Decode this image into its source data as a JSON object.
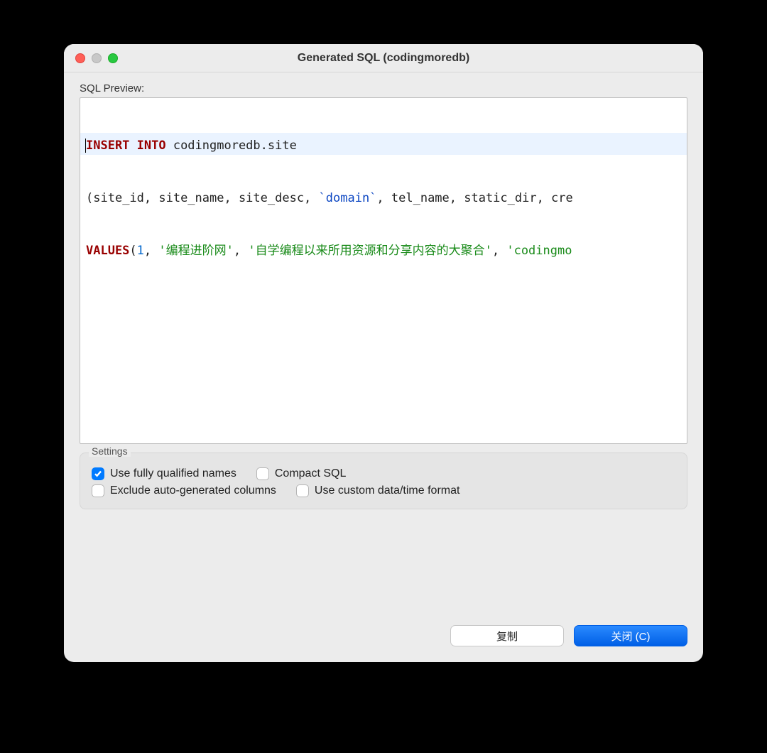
{
  "window": {
    "title": "Generated SQL (codingmoredb)"
  },
  "sql_preview": {
    "label": "SQL Preview:",
    "lines": {
      "l1_kw": "INSERT INTO",
      "l1_rest": " codingmoredb.site",
      "l2_open": "(",
      "l2_cols_a": "site_id, site_name, site_desc, ",
      "l2_back": "`domain`",
      "l2_cols_b": ", tel_name, static_dir, cre",
      "l3_kw": "VALUES",
      "l3_open": "(",
      "l3_num": "1",
      "l3_c1": ", ",
      "l3_s1": "'编程进阶网'",
      "l3_c2": ", ",
      "l3_s2": "'自学编程以来所用资源和分享内容的大聚合'",
      "l3_c3": ", ",
      "l3_s3": "'codingmo"
    }
  },
  "settings": {
    "title": "Settings",
    "use_fully_qualified": {
      "label": "Use fully qualified names",
      "checked": true
    },
    "compact_sql": {
      "label": "Compact SQL",
      "checked": false
    },
    "exclude_auto": {
      "label": "Exclude auto-generated columns",
      "checked": false
    },
    "use_custom_datetime": {
      "label": "Use custom data/time format",
      "checked": false
    }
  },
  "buttons": {
    "copy": "复制",
    "close": "关闭 (C)"
  }
}
